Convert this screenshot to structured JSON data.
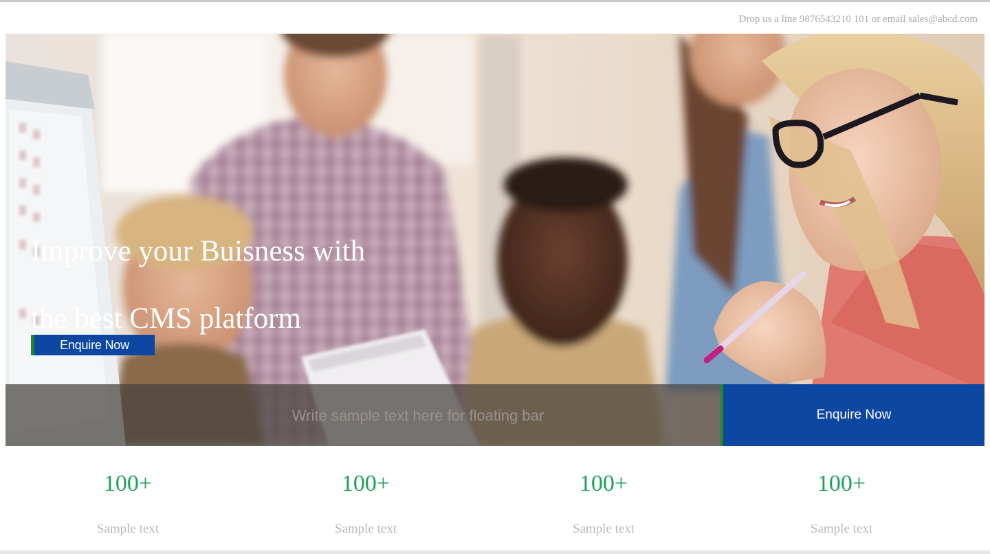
{
  "header": {
    "contact_text": "Drop us a line 9876543210 101 or email sales@abcd.com"
  },
  "hero": {
    "title_line1": "Improve your Buisness with",
    "title_line2": "the best CMS platform",
    "button_label": "Enquire Now"
  },
  "floating_bar": {
    "text": "Write sample text here for floating bar",
    "button_label": "Enquire Now"
  },
  "stats": [
    {
      "value": "100+",
      "label": "Sample text"
    },
    {
      "value": "100+",
      "label": "Sample text"
    },
    {
      "value": "100+",
      "label": "Sample text"
    },
    {
      "value": "100+",
      "label": "Sample text"
    }
  ],
  "colors": {
    "brand_blue": "#0d47a1",
    "accent_green": "#1b8a2a",
    "stat_green": "#1aa25a"
  }
}
